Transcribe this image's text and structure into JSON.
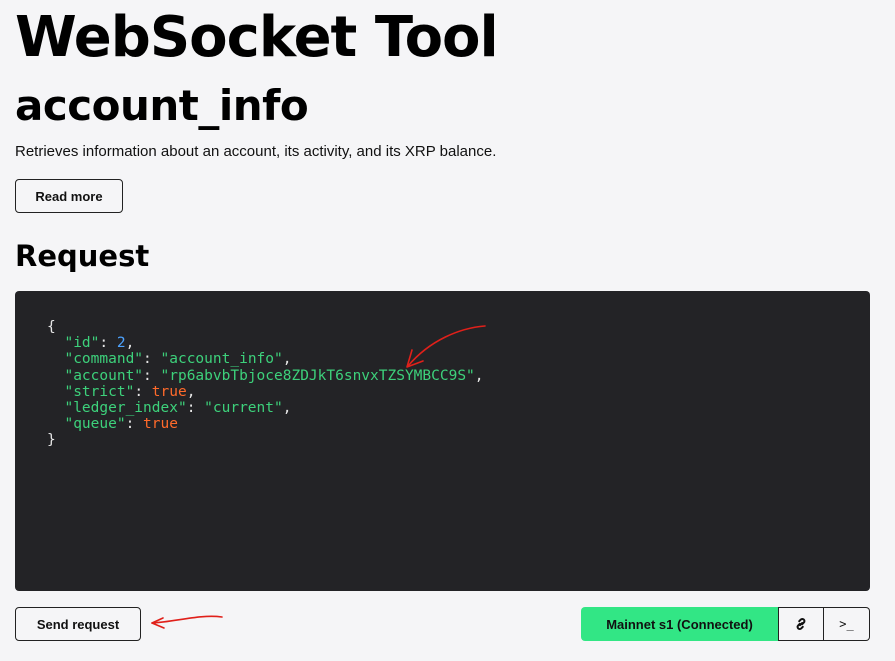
{
  "header": {
    "app_title": "WebSocket Tool",
    "method_title": "account_info",
    "description": "Retrieves information about an account, its activity, and its XRP balance.",
    "read_more_label": "Read more"
  },
  "request": {
    "section_title": "Request",
    "code": {
      "open_brace": "{",
      "close_brace": "}",
      "lines": [
        {
          "key": "\"id\"",
          "value": "2",
          "kind": "num",
          "trail": ","
        },
        {
          "key": "\"command\"",
          "value": "\"account_info\"",
          "kind": "str",
          "trail": ","
        },
        {
          "key": "\"account\"",
          "value": "\"rp6abvbTbjoce8ZDJkT6snvxTZSYMBCC9S\"",
          "kind": "str",
          "trail": ","
        },
        {
          "key": "\"strict\"",
          "value": "true",
          "kind": "bool",
          "trail": ","
        },
        {
          "key": "\"ledger_index\"",
          "value": "\"current\"",
          "kind": "str",
          "trail": ","
        },
        {
          "key": "\"queue\"",
          "value": "true",
          "kind": "bool",
          "trail": ""
        }
      ]
    }
  },
  "footer": {
    "send_label": "Send request",
    "connection_label": "Mainnet s1 (Connected)",
    "link_icon": "link-icon",
    "terminal_icon": "terminal-icon",
    "terminal_glyph": ">_"
  },
  "colors": {
    "accent_green": "#32e685",
    "editor_bg": "#232326",
    "token_key": "#3dd17b",
    "token_number": "#4da3ff",
    "token_bool": "#ff6a2b",
    "annotation_red": "#e0201a"
  }
}
